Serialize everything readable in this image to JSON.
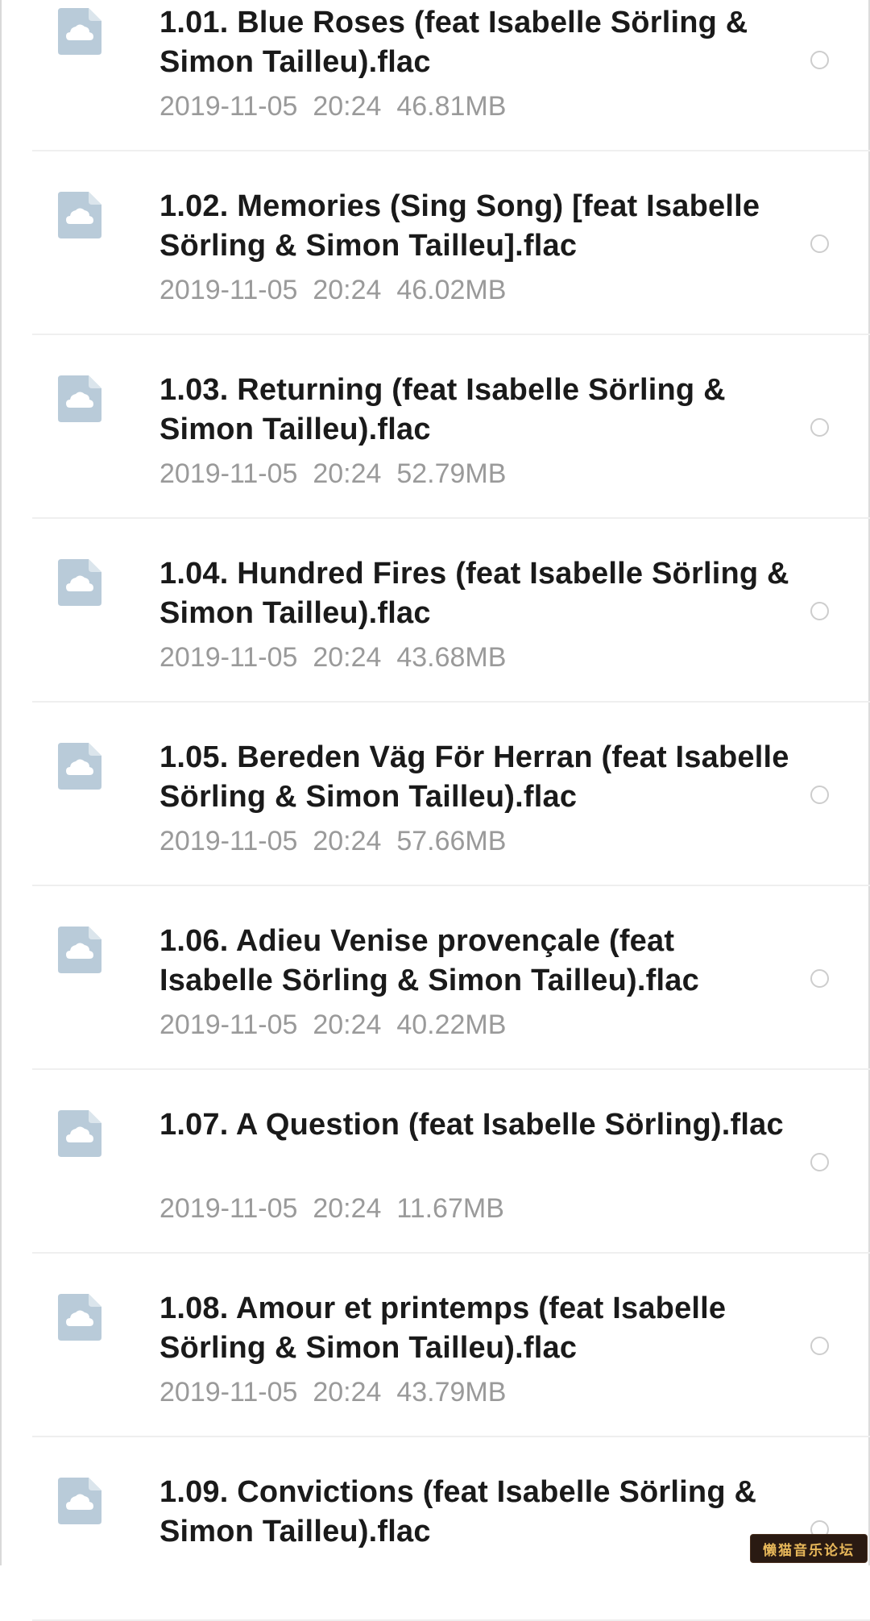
{
  "icons": {
    "file_icon": "cloud-file-icon",
    "file_icon_color": "#b9cbd9",
    "radio_border_color": "#cdcdcd"
  },
  "files": [
    {
      "name": "1.01. Blue Roses (feat Isabelle Sörling & Simon Tailleu).flac",
      "date": "2019-11-05",
      "time": "20:24",
      "size": "46.81MB"
    },
    {
      "name": "1.02. Memories (Sing Song) [feat Isabelle Sörling & Simon Tailleu].flac",
      "date": "2019-11-05",
      "time": "20:24",
      "size": "46.02MB"
    },
    {
      "name": "1.03. Returning (feat Isabelle Sörling & Simon Tailleu).flac",
      "date": "2019-11-05",
      "time": "20:24",
      "size": "52.79MB"
    },
    {
      "name": "1.04. Hundred Fires (feat Isabelle Sörling & Simon Tailleu).flac",
      "date": "2019-11-05",
      "time": "20:24",
      "size": "43.68MB"
    },
    {
      "name": "1.05. Bereden Väg För Herran (feat Isabelle Sörling & Simon Tailleu).flac",
      "date": "2019-11-05",
      "time": "20:24",
      "size": "57.66MB"
    },
    {
      "name": "1.06. Adieu Venise provençale (feat Isabelle Sörling & Simon Tailleu).flac",
      "date": "2019-11-05",
      "time": "20:24",
      "size": "40.22MB"
    },
    {
      "name": "1.07. A Question (feat Isabelle Sörling).flac",
      "date": "2019-11-05",
      "time": "20:24",
      "size": "11.67MB"
    },
    {
      "name": "1.08. Amour et printemps (feat Isabelle Sörling & Simon Tailleu).flac",
      "date": "2019-11-05",
      "time": "20:24",
      "size": "43.79MB"
    },
    {
      "name": "1.09. Convictions (feat Isabelle Sörling & Simon Tailleu).flac",
      "date": "",
      "time": "",
      "size": ""
    }
  ],
  "watermark": {
    "text": "懒猫音乐论坛"
  }
}
